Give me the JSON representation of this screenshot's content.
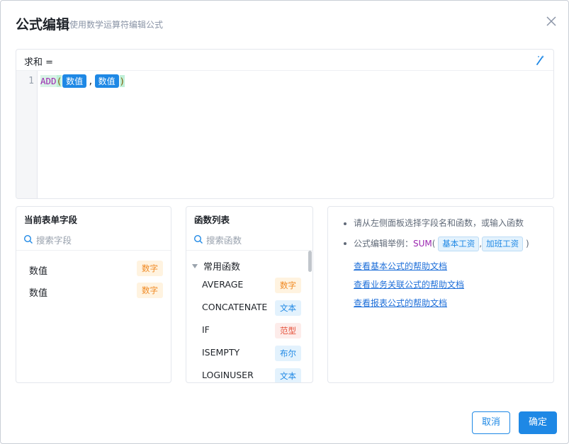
{
  "dialog": {
    "title": "公式编辑",
    "subtitle": "使用数学运算符编辑公式",
    "close_icon": "close-icon"
  },
  "editor": {
    "label": "求和 =",
    "line_number": "1",
    "formula": {
      "function": "ADD",
      "open_paren": "(",
      "arg1": "数值",
      "comma": ",",
      "arg2": "数值",
      "close_paren": ")"
    },
    "format_icon": "magic-wand-icon"
  },
  "fields_panel": {
    "title": "当前表单字段",
    "search_placeholder": "搜索字段",
    "items": [
      {
        "name": "数值",
        "type": "数字"
      },
      {
        "name": "数值",
        "type": "数字"
      }
    ]
  },
  "functions_panel": {
    "title": "函数列表",
    "search_placeholder": "搜索函数",
    "group": "常用函数",
    "items": [
      {
        "name": "AVERAGE",
        "type": "数字"
      },
      {
        "name": "CONCATENATE",
        "type": "文本"
      },
      {
        "name": "IF",
        "type": "范型"
      },
      {
        "name": "ISEMPTY",
        "type": "布尔"
      },
      {
        "name": "LOGINUSER",
        "type": "文本"
      }
    ]
  },
  "help_panel": {
    "tip1": "请从左侧面板选择字段名和函数，或输入函数",
    "tip2_prefix": "公式编辑举例：",
    "tip2_fn": "SUM",
    "tip2_open": "(",
    "tip2_arg1": "基本工资",
    "tip2_comma": ",",
    "tip2_arg2": "加班工资",
    "tip2_close": ")",
    "links": [
      "查看基本公式的帮助文档",
      "查看业务关联公式的帮助文档",
      "查看报表公式的帮助文档"
    ]
  },
  "footer": {
    "cancel_label": "取消",
    "confirm_label": "确定"
  },
  "colors": {
    "primary": "#1e88e5",
    "number_tag": "#f08a24",
    "generic_tag": "#e55039",
    "function_text": "#9c27b0"
  }
}
